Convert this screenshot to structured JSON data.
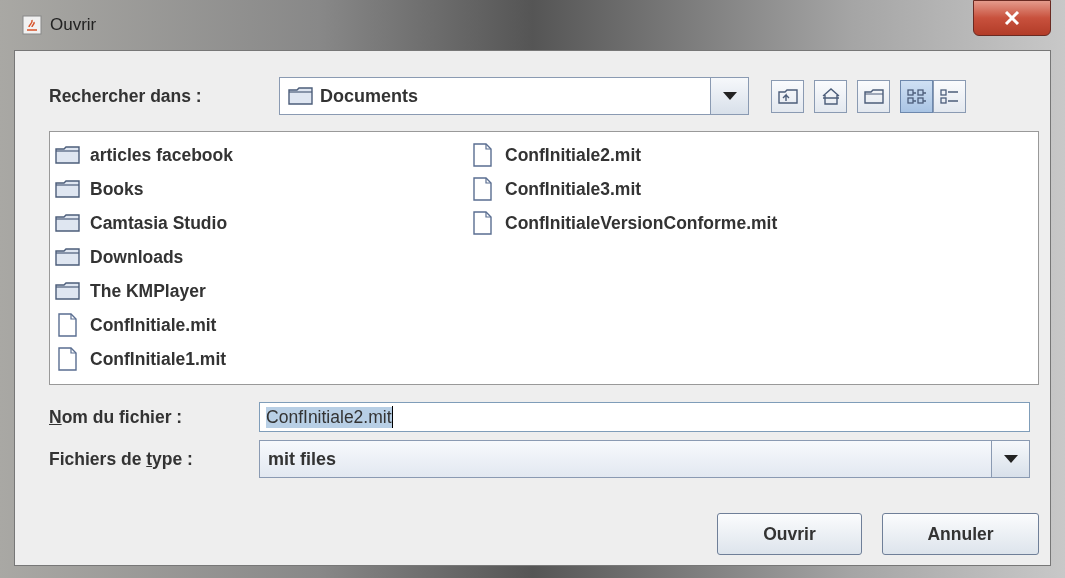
{
  "window": {
    "title": "Ouvrir"
  },
  "look_in": {
    "label": "Rechercher dans :",
    "value": "Documents"
  },
  "toolbar": [
    {
      "kind": "up",
      "selected": false
    },
    {
      "kind": "home",
      "selected": false
    },
    {
      "kind": "new-folder",
      "selected": false
    },
    {
      "kind": "list",
      "selected": true
    },
    {
      "kind": "details",
      "selected": false
    }
  ],
  "files": [
    {
      "name": "articles facebook",
      "kind": "folder"
    },
    {
      "name": "Books",
      "kind": "folder"
    },
    {
      "name": "Camtasia Studio",
      "kind": "folder"
    },
    {
      "name": "Downloads",
      "kind": "folder"
    },
    {
      "name": "The KMPlayer",
      "kind": "folder"
    },
    {
      "name": "ConfInitiale.mit",
      "kind": "file"
    },
    {
      "name": "ConfInitiale1.mit",
      "kind": "file"
    },
    {
      "name": "ConfInitiale2.mit",
      "kind": "file"
    },
    {
      "name": "ConfInitiale3.mit",
      "kind": "file"
    },
    {
      "name": "ConfInitialeVersionConforme.mit",
      "kind": "file"
    }
  ],
  "file_name": {
    "label": {
      "key": "N",
      "after": "om du fichier :"
    },
    "value": "ConfInitiale2.mit",
    "text_selected": true
  },
  "file_type": {
    "label": {
      "before": "Fichiers de ",
      "key": "t",
      "after": "ype :"
    },
    "value": "mit files"
  },
  "buttons": [
    "Ouvrir",
    "Annuler"
  ]
}
